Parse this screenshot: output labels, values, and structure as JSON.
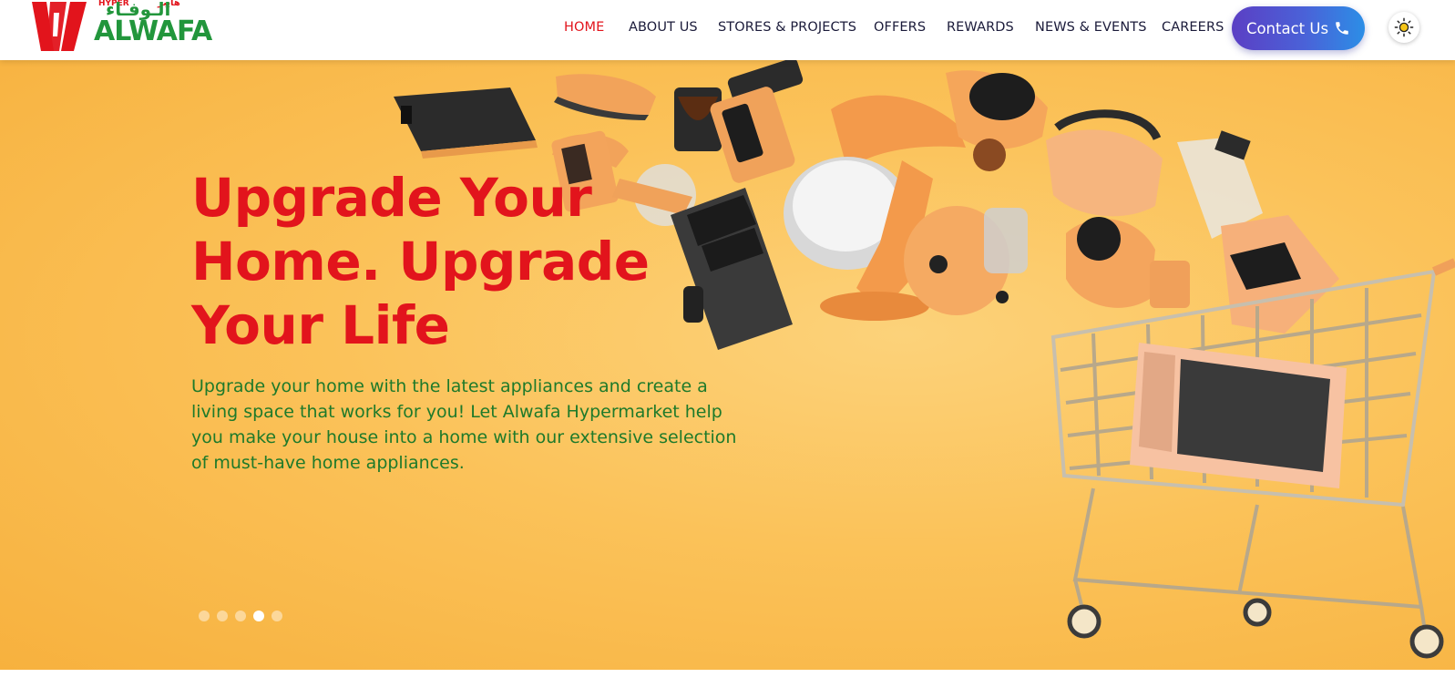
{
  "brand": {
    "name": "ALWAFA",
    "arabic_name": "الـوفـاء",
    "tag_en": "HYPER",
    "tag_ar": "هايبر",
    "colors": {
      "red": "#e2141c",
      "green": "#22963c"
    }
  },
  "nav": {
    "items": [
      {
        "label": "HOME",
        "active": true
      },
      {
        "label": "ABOUT US",
        "active": false
      },
      {
        "label": "STORES & PROJECTS",
        "active": false
      },
      {
        "label": "OFFERS",
        "active": false
      },
      {
        "label": "REWARDS",
        "active": false
      },
      {
        "label": "NEWS & EVENTS",
        "active": false
      },
      {
        "label": "CAREERS",
        "active": false
      }
    ],
    "contact_label": "Contact Us",
    "contact_icon": "phone-icon",
    "theme_icon": "sun-icon"
  },
  "hero": {
    "title": "Upgrade Your Home. Upgrade Your Life",
    "description": "Upgrade your home with the latest appliances and create a living space that works for you! Let Alwafa Hypermarket help you make your house into a home with our extensive selection of must-have home appliances.",
    "background_color": "#fbc259",
    "title_color": "#e2141c",
    "description_color": "#1e7a2a",
    "slides": 5,
    "active_slide": 4
  }
}
